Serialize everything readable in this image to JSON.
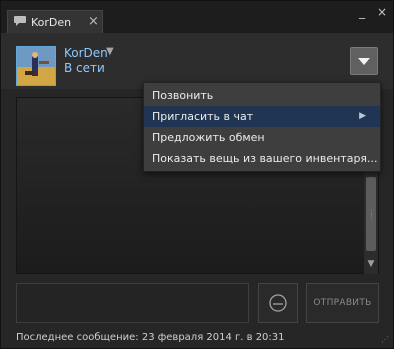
{
  "window": {
    "tab_title": "KorDen",
    "tab_close": "×",
    "minimize": "_",
    "close": "×"
  },
  "friend": {
    "name": "KorDen",
    "status": "В сети",
    "name_arrow": "▼"
  },
  "menu": {
    "items": [
      {
        "label": "Позвонить"
      },
      {
        "label": "Пригласить в чат",
        "submenu_arrow": "▶"
      },
      {
        "label": "Предложить обмен"
      },
      {
        "label": "Показать вещь из вашего инвентаря..."
      }
    ]
  },
  "input": {
    "value": "",
    "send_label": "ОТПРАВИТЬ"
  },
  "footer": {
    "last_message": "Последнее сообщение: 23 февраля 2014 г. в 20:31"
  },
  "colors": {
    "accent": "#8ec8ff",
    "menu_highlight": "#1f3553"
  }
}
